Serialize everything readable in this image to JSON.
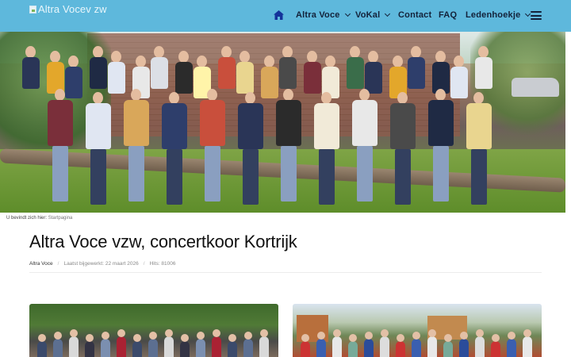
{
  "header": {
    "logo_alt": "Altra Vocev zw",
    "nav": [
      {
        "label": "Altra Voce",
        "dropdown": true
      },
      {
        "label": "VoKal",
        "dropdown": true
      },
      {
        "label": "Contact",
        "dropdown": false
      },
      {
        "label": "FAQ",
        "dropdown": false
      },
      {
        "label": "Ledenhoekje",
        "dropdown": true
      }
    ],
    "home_icon": "home-icon",
    "menu_icon": "hamburger-menu-icon",
    "bar_color": "#5eb8dc"
  },
  "hero": {
    "image": "choir-group-photo"
  },
  "breadcrumb": {
    "prefix": "U bevindt zich hier:",
    "current": "Startpagina"
  },
  "article": {
    "title": "Altra Voce vzw, concertkoor Kortrijk",
    "category": "Altra Voce",
    "updated": "Laatst bijgewerkt: 22 maart 2026",
    "hits": "Hits: 81006"
  },
  "gallery": [
    {
      "image": "choir-photo-park"
    },
    {
      "image": "choir-photo-outdoor"
    }
  ]
}
